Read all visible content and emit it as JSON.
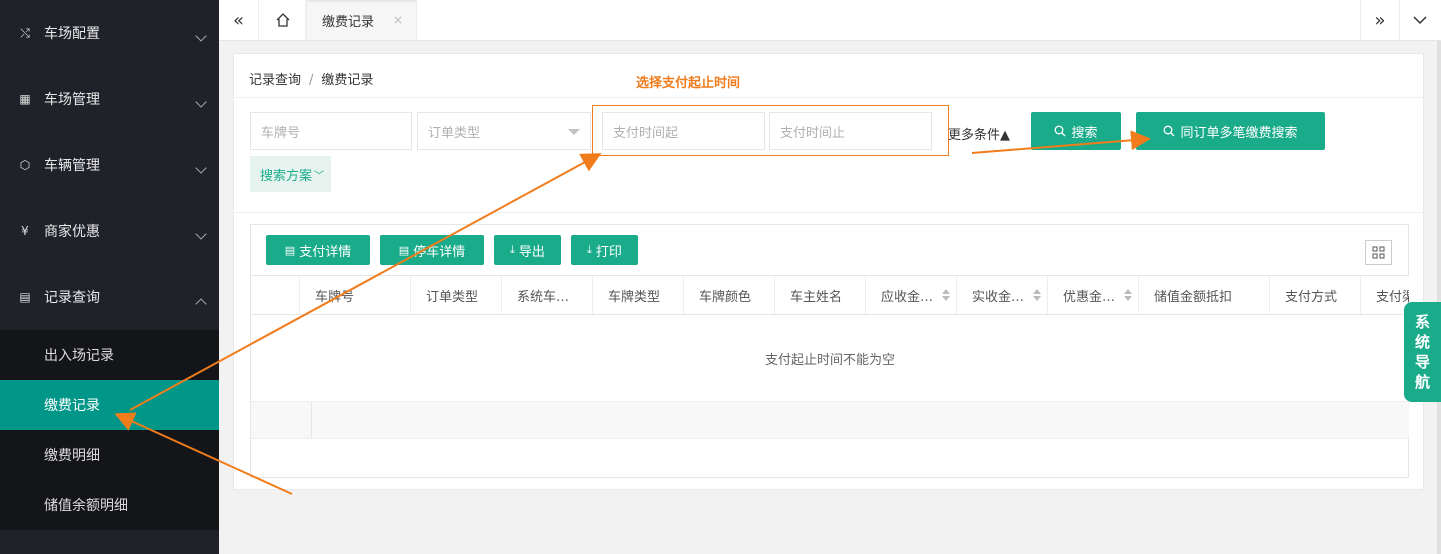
{
  "sidebar": {
    "menus": [
      {
        "label": "车场配置",
        "icon": "tools-icon"
      },
      {
        "label": "车场管理",
        "icon": "grid-icon"
      },
      {
        "label": "车辆管理",
        "icon": "cube-icon"
      },
      {
        "label": "商家优惠",
        "icon": "yen-icon"
      },
      {
        "label": "记录查询",
        "icon": "clipboard-icon"
      }
    ],
    "submenu": [
      "出入场记录",
      "缴费记录",
      "缴费明细",
      "储值余额明细"
    ]
  },
  "topbar": {
    "tab_label": "缴费记录",
    "tab_close": "×"
  },
  "breadcrumb": {
    "root": "记录查询",
    "separator": "/",
    "current": "缴费记录"
  },
  "search": {
    "plate_placeholder": "车牌号",
    "order_type_placeholder": "订单类型",
    "pay_time_start_placeholder": "支付时间起",
    "pay_time_end_placeholder": "支付时间止",
    "more_conditions": "更多条件▲",
    "search_label": "搜索",
    "multi_search_label": "同订单多笔缴费搜索",
    "scheme_label": "搜索方案"
  },
  "annotation": {
    "text": "选择支付起止时间",
    "color": "#f07c1c"
  },
  "toolbar": {
    "pay_detail": "支付详情",
    "park_detail": "停车详情",
    "export": "导出",
    "print": "打印"
  },
  "table": {
    "columns": [
      "车牌号",
      "订单类型",
      "系统车…",
      "车牌类型",
      "车牌颜色",
      "车主姓名",
      "应收金…",
      "实收金…",
      "优惠金…",
      "储值金额抵扣",
      "支付方式",
      "支付渠"
    ],
    "empty_text": "支付起止时间不能为空"
  },
  "sysnav": {
    "chars": [
      "系",
      "统",
      "导",
      "航"
    ]
  },
  "colors": {
    "accent": "#1aab8a",
    "sidebar": "#20222a",
    "active": "#009688"
  }
}
